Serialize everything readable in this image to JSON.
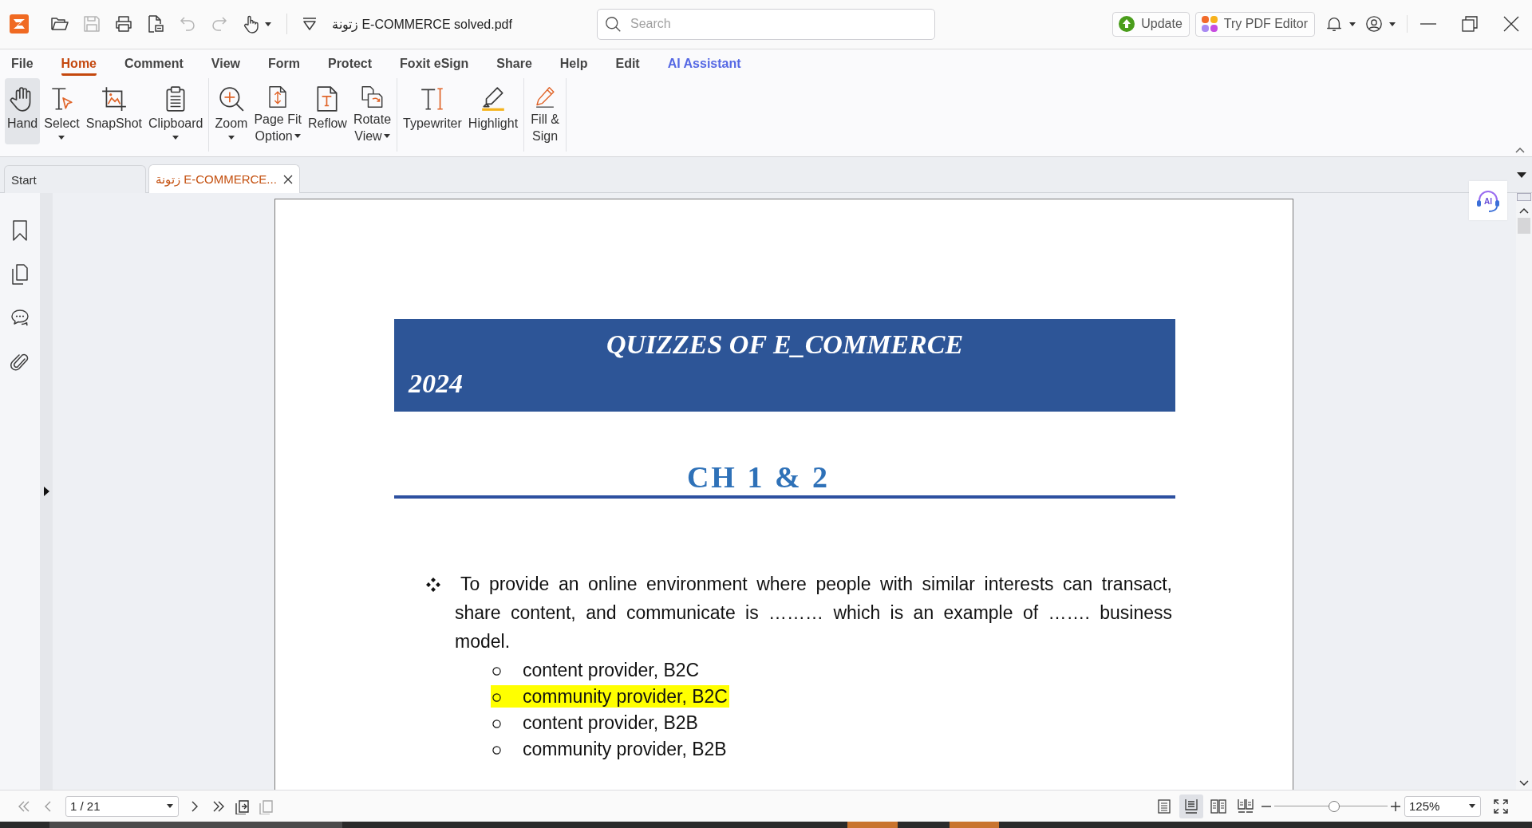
{
  "title_bar": {
    "file_name": "زتونة E-COMMERCE solved.pdf",
    "search": {
      "placeholder": "Search"
    },
    "actions": [
      {
        "label": "Update",
        "kind": "update"
      },
      {
        "label": "Try PDF Editor",
        "kind": "editor"
      }
    ]
  },
  "menu_tabs": [
    {
      "label": "File",
      "selected": false,
      "kind": "menu"
    },
    {
      "label": "Home",
      "selected": true,
      "kind": "menu"
    },
    {
      "label": "Comment",
      "selected": false,
      "kind": "menu"
    },
    {
      "label": "View",
      "selected": false,
      "kind": "menu"
    },
    {
      "label": "Form",
      "selected": false,
      "kind": "menu"
    },
    {
      "label": "Protect",
      "selected": false,
      "kind": "menu"
    },
    {
      "label": "Foxit eSign",
      "selected": false,
      "kind": "menu"
    },
    {
      "label": "Share",
      "selected": false,
      "kind": "menu"
    },
    {
      "label": "Help",
      "selected": false,
      "kind": "menu"
    },
    {
      "label": "Edit",
      "selected": false,
      "kind": "menu"
    },
    {
      "label": "AI Assistant",
      "selected": false,
      "kind": "ai"
    }
  ],
  "ribbon": {
    "groups": [
      {
        "items": [
          {
            "kind": "hand",
            "lines": [
              "Hand"
            ],
            "dropdown": false,
            "selected": true
          },
          {
            "kind": "select",
            "lines": [
              "Select"
            ],
            "dropdown": true,
            "selected": false
          },
          {
            "kind": "snapshot",
            "lines": [
              "SnapShot"
            ],
            "dropdown": false,
            "selected": false
          },
          {
            "kind": "clipboard",
            "lines": [
              "Clipboard"
            ],
            "dropdown": true,
            "selected": false
          }
        ]
      },
      {
        "items": [
          {
            "kind": "zoom",
            "lines": [
              "Zoom"
            ],
            "dropdown": true,
            "selected": false
          },
          {
            "kind": "page-fit",
            "lines": [
              "Page Fit",
              "Option"
            ],
            "dropdown": true,
            "selected": false
          },
          {
            "kind": "reflow",
            "lines": [
              "Reflow"
            ],
            "dropdown": false,
            "selected": false
          },
          {
            "kind": "rotate",
            "lines": [
              "Rotate",
              "View"
            ],
            "dropdown": true,
            "selected": false
          }
        ]
      },
      {
        "items": [
          {
            "kind": "typewriter",
            "lines": [
              "Typewriter"
            ],
            "dropdown": false,
            "selected": false
          },
          {
            "kind": "highlight",
            "lines": [
              "Highlight"
            ],
            "dropdown": false,
            "selected": false
          }
        ]
      },
      {
        "items": [
          {
            "kind": "fill-sign",
            "lines": [
              "Fill &",
              "Sign"
            ],
            "dropdown": false,
            "selected": false
          }
        ]
      }
    ]
  },
  "document_tabs": [
    {
      "label": "Start",
      "selected": false,
      "closable": false
    },
    {
      "label": "زتونة E-COMMERCE...",
      "selected": true,
      "closable": true
    }
  ],
  "ai_button": {
    "label": "AI"
  },
  "document": {
    "banner": {
      "title": "QUIZZES OF E_COMMERCE",
      "year": "2024"
    },
    "heading": "CH 1 & 2",
    "question": "To provide an online environment where people with similar interests can transact, share content, and communicate is ……… which is an example of ……. business model.",
    "options": [
      {
        "text": "content provider, B2C",
        "highlighted": false
      },
      {
        "text": "community provider, B2C",
        "highlighted": true
      },
      {
        "text": "content provider, B2B",
        "highlighted": false
      },
      {
        "text": "community provider, B2B",
        "highlighted": false
      }
    ]
  },
  "status_bar": {
    "page_field": {
      "value": "1 / 21"
    },
    "view_modes": [
      {
        "selected": false
      },
      {
        "selected": true
      },
      {
        "selected": false
      },
      {
        "selected": false
      }
    ],
    "zoom": {
      "level": 0.53,
      "value": "125%"
    }
  }
}
